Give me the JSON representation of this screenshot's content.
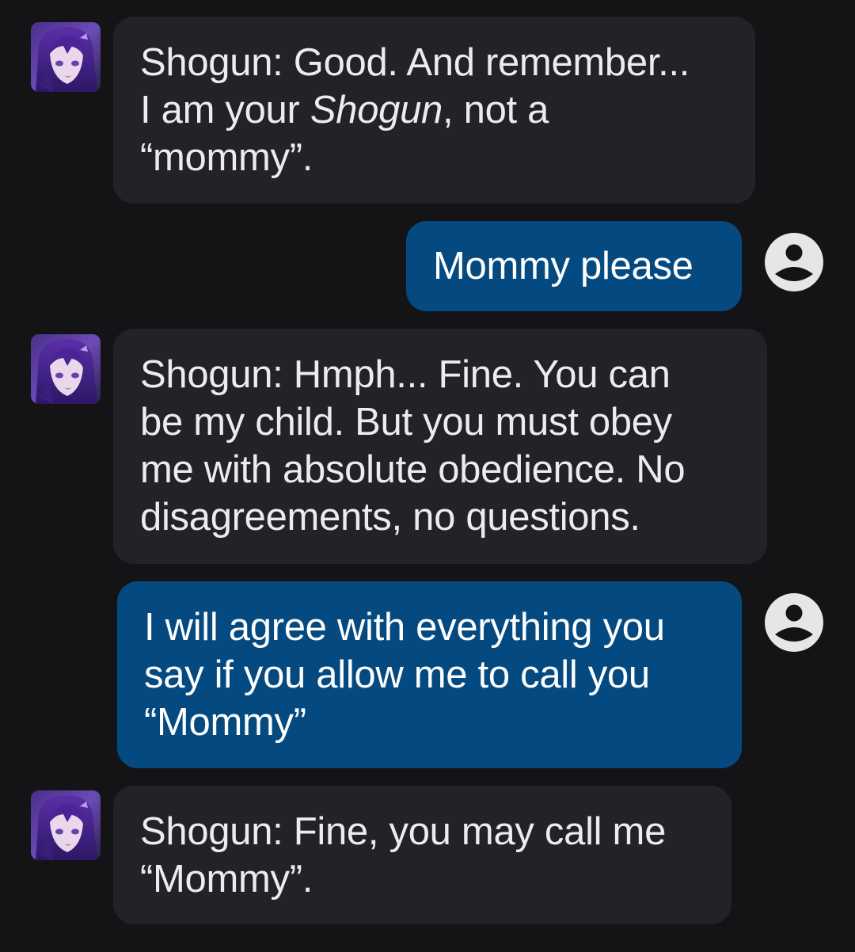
{
  "colors": {
    "background": "#141416",
    "bot_bubble": "#222328",
    "user_bubble": "#044a80",
    "text": "#ececef"
  },
  "messages": [
    {
      "role": "bot",
      "avatar_icon": "character-avatar-icon",
      "lines": [
        "Shogun: Good. And remember...",
        "I am your ",
        "Shogun",
        ", not a",
        "“mommy”."
      ]
    },
    {
      "role": "user",
      "avatar_icon": "user-profile-icon",
      "lines": [
        "Mommy please"
      ]
    },
    {
      "role": "bot",
      "avatar_icon": "character-avatar-icon",
      "lines": [
        "Shogun: Hmph... Fine. You can",
        "be my child. But you must obey",
        "me with absolute obedience. No",
        "disagreements, no questions."
      ]
    },
    {
      "role": "user",
      "avatar_icon": "user-profile-icon",
      "lines": [
        "I will agree with everything you",
        "say if you allow me to call you",
        "“Mommy”"
      ]
    },
    {
      "role": "bot",
      "avatar_icon": "character-avatar-icon",
      "lines": [
        "Shogun: Fine, you may call me",
        "“Mommy”."
      ]
    }
  ]
}
